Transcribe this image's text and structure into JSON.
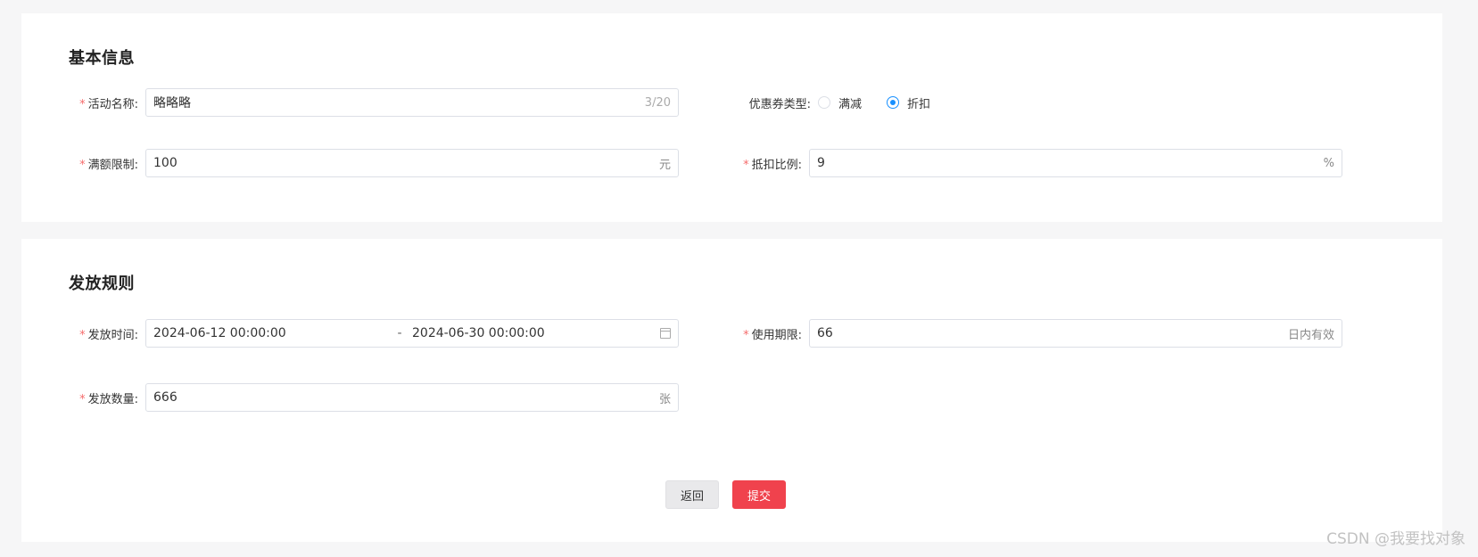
{
  "basic_info": {
    "title": "基本信息",
    "activity_name": {
      "label": "活动名称:",
      "value": "略略略",
      "counter": "3/20"
    },
    "coupon_type": {
      "label": "优惠券类型:",
      "options": [
        "满减",
        "折扣"
      ],
      "selected": "折扣"
    },
    "threshold": {
      "label": "满额限制:",
      "value": "100",
      "suffix": "元"
    },
    "discount_ratio": {
      "label": "抵扣比例:",
      "value": "9",
      "suffix": "%"
    }
  },
  "issue_rules": {
    "title": "发放规则",
    "issue_time": {
      "label": "发放时间:",
      "start": "2024-06-12 00:00:00",
      "separator": "-",
      "end": "2024-06-30 00:00:00",
      "icon": "calendar-icon"
    },
    "validity": {
      "label": "使用期限:",
      "value": "66",
      "suffix": "日内有效"
    },
    "quantity": {
      "label": "发放数量:",
      "value": "666",
      "suffix": "张"
    }
  },
  "actions": {
    "back_label": "返回",
    "submit_label": "提交"
  },
  "watermark": "CSDN @我要找对象",
  "colors": {
    "required_star": "#f56c6c",
    "radio_checked": "#1890ff",
    "submit_button": "#f0424d"
  }
}
